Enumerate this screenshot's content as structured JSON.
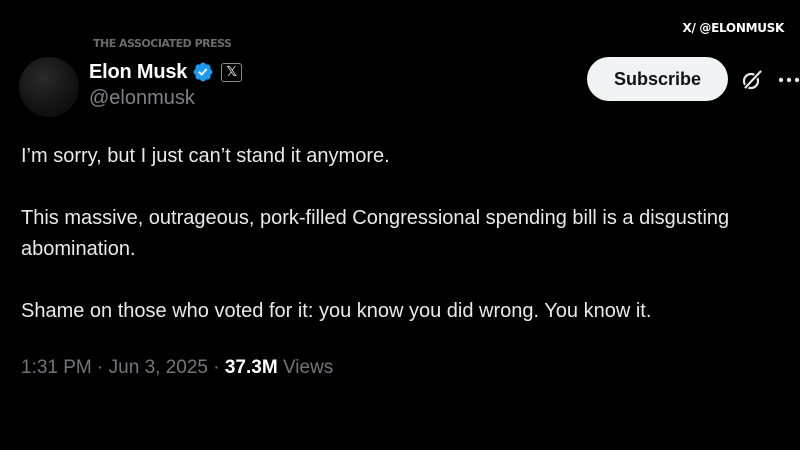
{
  "overlay": {
    "source_credit": "THE ASSOCIATED PRESS",
    "handle_credit": "X/ @ELONMUSK"
  },
  "author": {
    "display_name": "Elon Musk",
    "handle": "@elonmusk",
    "verified_icon": "verified-badge-icon",
    "affiliate_icon": "x-logo-icon",
    "affiliate_glyph": "𝕏"
  },
  "actions": {
    "subscribe_label": "Subscribe",
    "grok_icon": "grok-icon",
    "more_icon": "more-icon"
  },
  "tweet": {
    "paragraphs": [
      "I’m sorry, but I just can’t stand it anymore.",
      "This massive, outrageous, pork-filled Congressional spending bill is a disgusting abomination.",
      "Shame on those who voted for it: you know you did wrong. You know it."
    ]
  },
  "meta": {
    "time": "1:31 PM",
    "separator": " · ",
    "date": "Jun 3, 2025",
    "views_count": "37.3M",
    "views_label": "Views"
  },
  "colors": {
    "background": "#000000",
    "text": "#e7e9ea",
    "muted": "#71767b",
    "verified": "#1d9bf0",
    "button_bg": "#eff3f4"
  }
}
